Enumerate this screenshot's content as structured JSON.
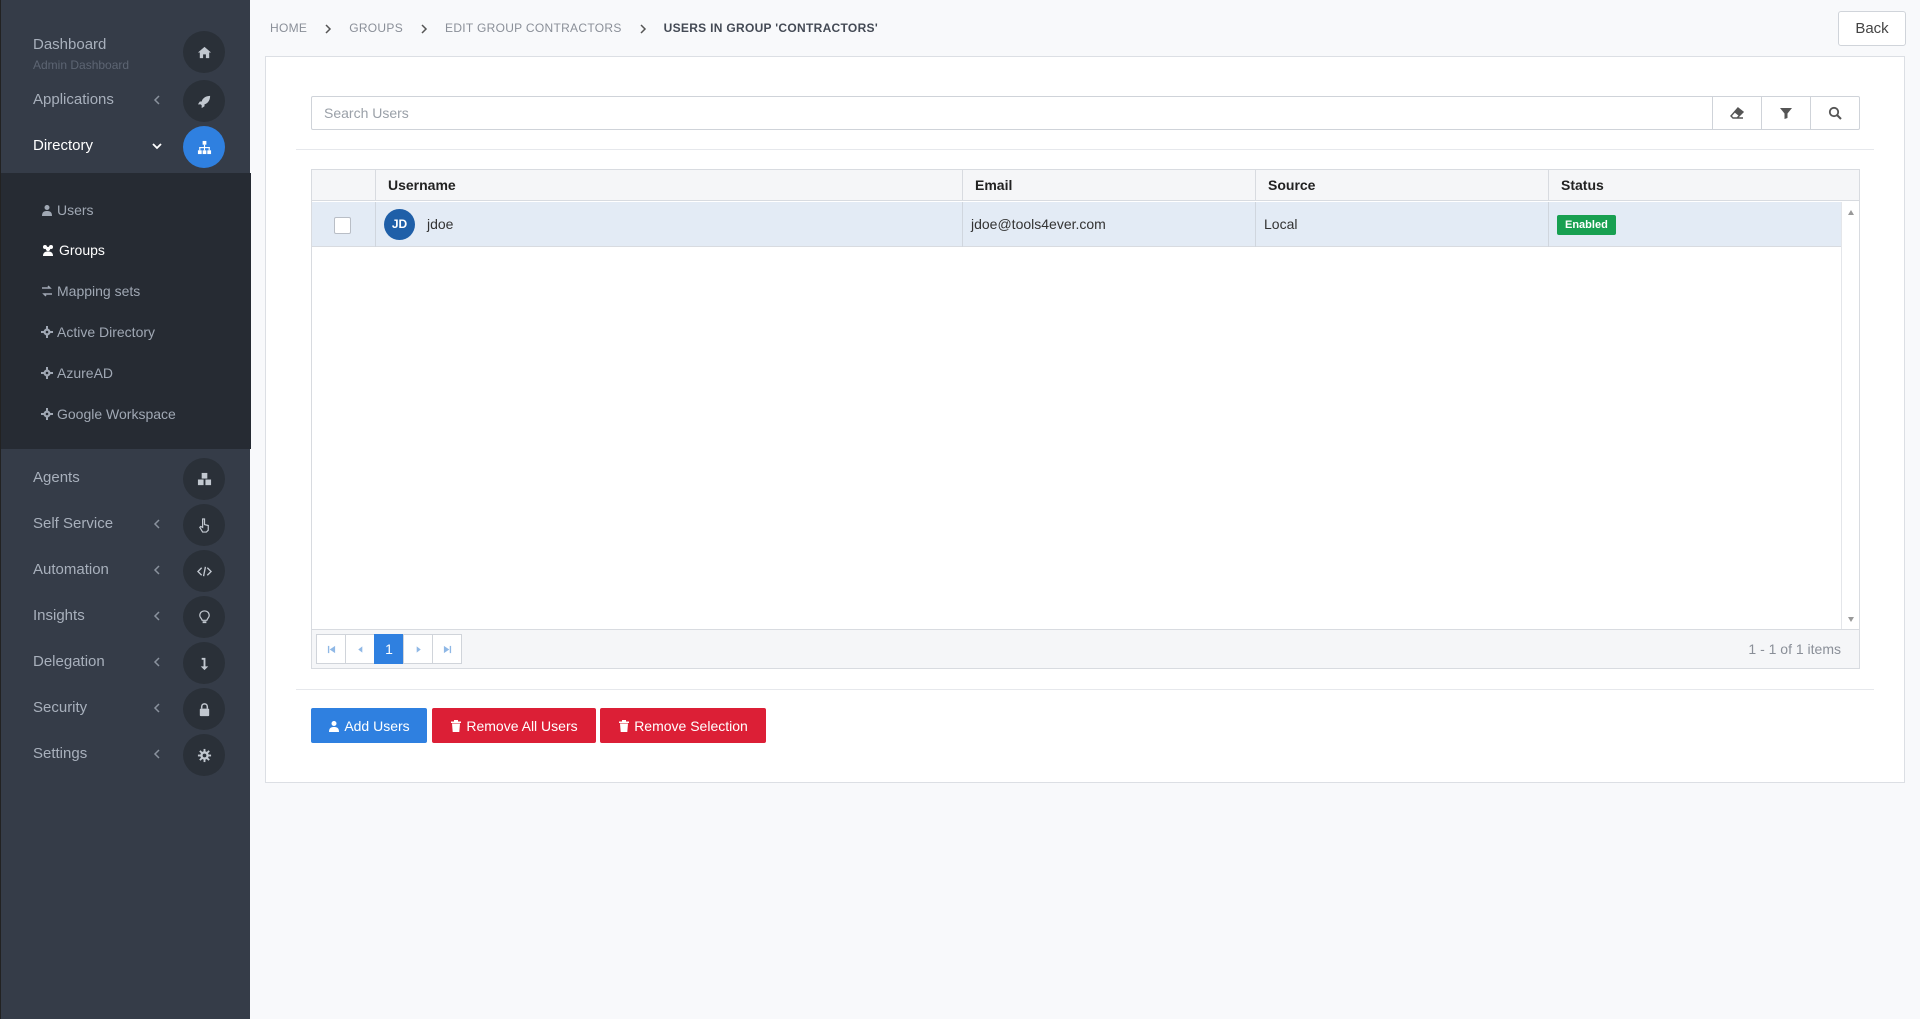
{
  "sidebar": {
    "dashboard": {
      "label": "Dashboard",
      "sub": "Admin Dashboard"
    },
    "items": [
      {
        "label": "Applications"
      },
      {
        "label": "Directory"
      },
      {
        "label": "Agents"
      },
      {
        "label": "Self Service"
      },
      {
        "label": "Automation"
      },
      {
        "label": "Insights"
      },
      {
        "label": "Delegation"
      },
      {
        "label": "Security"
      },
      {
        "label": "Settings"
      }
    ],
    "directory_sub": [
      {
        "label": "Users"
      },
      {
        "label": "Groups"
      },
      {
        "label": "Mapping sets"
      },
      {
        "label": "Active Directory"
      },
      {
        "label": "AzureAD"
      },
      {
        "label": "Google Workspace"
      }
    ]
  },
  "breadcrumb": [
    "HOME",
    "GROUPS",
    "EDIT GROUP CONTRACTORS",
    "USERS IN GROUP 'CONTRACTORS'"
  ],
  "back_label": "Back",
  "search": {
    "placeholder": "Search Users"
  },
  "table": {
    "columns": [
      "Username",
      "Email",
      "Source",
      "Status"
    ],
    "rows": [
      {
        "initials": "JD",
        "username": "jdoe",
        "email": "jdoe@tools4ever.com",
        "source": "Local",
        "status": "Enabled"
      }
    ]
  },
  "pager": {
    "current_page": "1",
    "info": "1 - 1 of 1 items"
  },
  "actions": {
    "add": "Add Users",
    "remove_all": "Remove All Users",
    "remove_selection": "Remove Selection"
  },
  "colors": {
    "accent": "#2f80e0",
    "danger": "#dc1f36",
    "success": "#18a051",
    "sidebar": "#353c48"
  }
}
